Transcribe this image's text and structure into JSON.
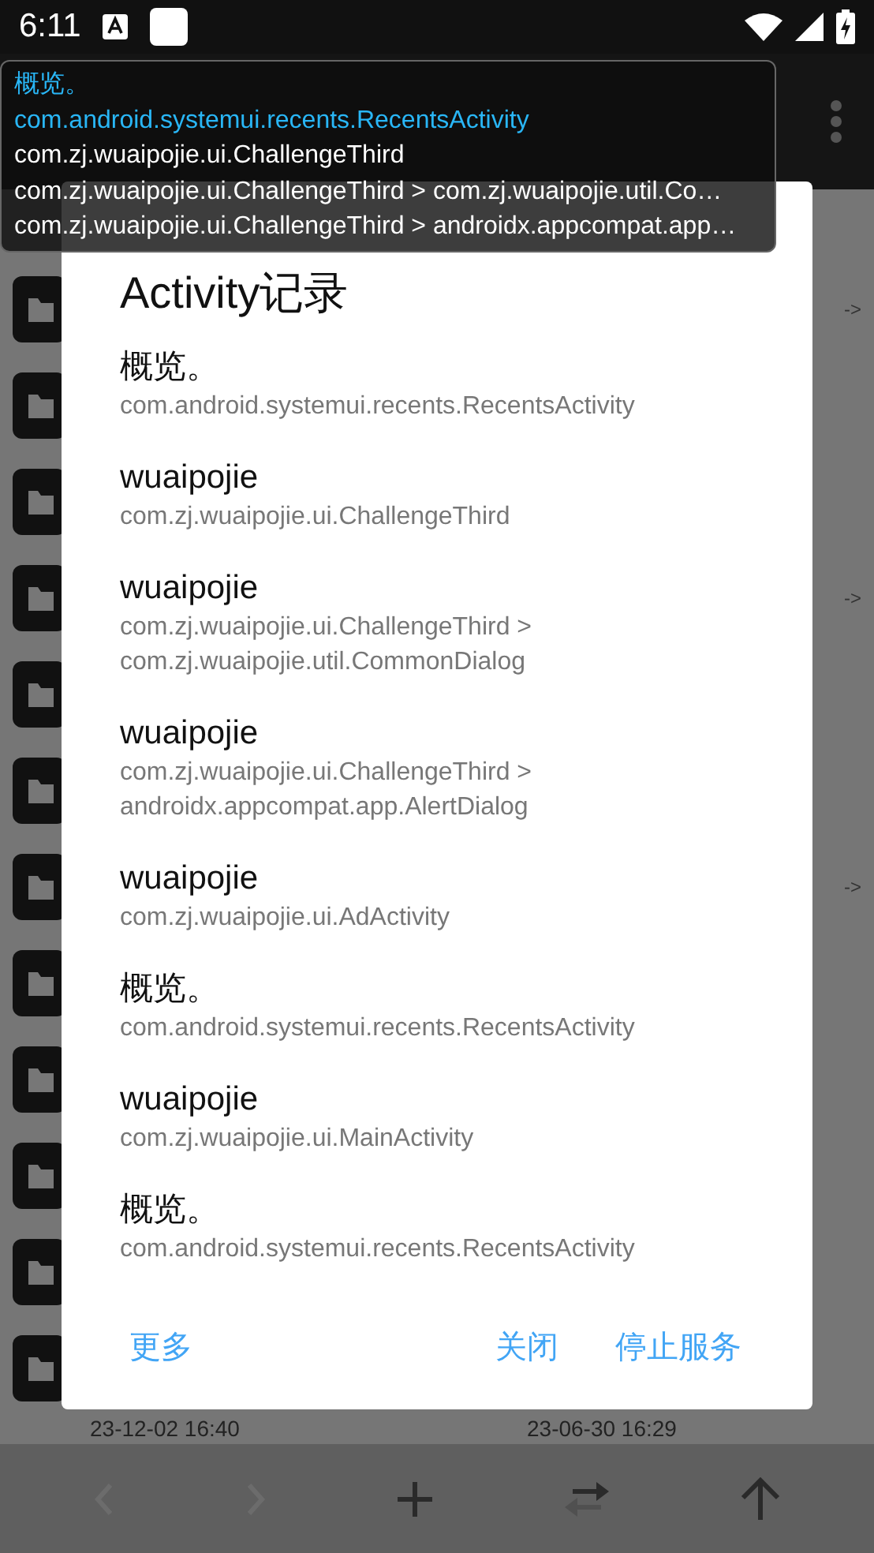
{
  "status_bar": {
    "time": "6:11"
  },
  "file_list": {
    "arrows": [
      "->",
      "->",
      "->"
    ],
    "dates": [
      "23-12-02 16:40",
      "23-06-30 16:29"
    ]
  },
  "dialog": {
    "title": "Activity记录",
    "items": [
      {
        "label": "概览。",
        "activity": "com.android.systemui.recents.RecentsActivity"
      },
      {
        "label": "wuaipojie",
        "activity": "com.zj.wuaipojie.ui.ChallengeThird"
      },
      {
        "label": "wuaipojie",
        "activity": "com.zj.wuaipojie.ui.ChallengeThird > com.zj.wuaipojie.util.CommonDialog"
      },
      {
        "label": "wuaipojie",
        "activity": "com.zj.wuaipojie.ui.ChallengeThird > androidx.appcompat.app.AlertDialog"
      },
      {
        "label": "wuaipojie",
        "activity": "com.zj.wuaipojie.ui.AdActivity"
      },
      {
        "label": "概览。",
        "activity": "com.android.systemui.recents.RecentsActivity"
      },
      {
        "label": "wuaipojie",
        "activity": "com.zj.wuaipojie.ui.MainActivity"
      },
      {
        "label": "概览。",
        "activity": "com.android.systemui.recents.RecentsActivity"
      }
    ],
    "buttons": [
      "更多",
      "关闭",
      "停止服务"
    ]
  },
  "floating_log": {
    "lines": [
      {
        "text": "概览。",
        "highlighted": true
      },
      {
        "text": "com.android.systemui.recents.RecentsActivity",
        "highlighted": true
      },
      {
        "text": "com.zj.wuaipojie.ui.ChallengeThird",
        "highlighted": false
      },
      {
        "text": "com.zj.wuaipojie.ui.ChallengeThird > com.zj.wuaipojie.util.Co…",
        "highlighted": false
      },
      {
        "text": "com.zj.wuaipojie.ui.ChallengeThird > androidx.appcompat.app…",
        "highlighted": false
      }
    ]
  },
  "bottom_toolbar": {
    "buttons": [
      {
        "kind": "back",
        "disabled": true
      },
      {
        "kind": "forward",
        "disabled": true
      },
      {
        "kind": "add",
        "disabled": false
      },
      {
        "kind": "swap",
        "disabled": false
      },
      {
        "kind": "up",
        "disabled": false
      }
    ]
  }
}
